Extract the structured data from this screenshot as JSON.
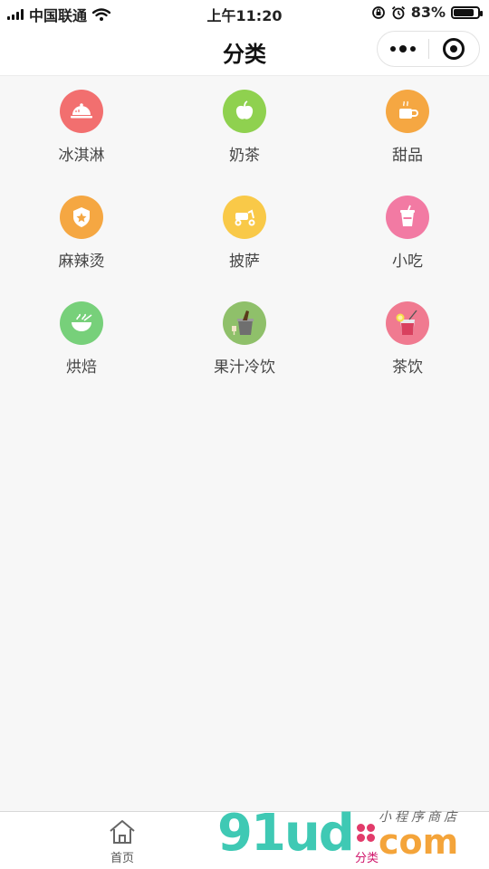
{
  "status_bar": {
    "carrier": "中国联通",
    "time": "上午11:20",
    "battery": "83%",
    "battery_level": 0.83
  },
  "nav": {
    "title": "分类"
  },
  "categories": [
    {
      "label": "冰淇淋",
      "icon": "cloche-icon",
      "color": "#f26f6f"
    },
    {
      "label": "奶茶",
      "icon": "apple-icon",
      "color": "#8fd14f"
    },
    {
      "label": "甜品",
      "icon": "coffee-cup-icon",
      "color": "#f5a742"
    },
    {
      "label": "麻辣烫",
      "icon": "star-badge-icon",
      "color": "#f5a742"
    },
    {
      "label": "披萨",
      "icon": "scooter-icon",
      "color": "#f9c948"
    },
    {
      "label": "小吃",
      "icon": "drink-cup-icon",
      "color": "#f27aa3"
    },
    {
      "label": "烘焙",
      "icon": "bowl-icon",
      "color": "#77d07a"
    },
    {
      "label": "果汁冷饮",
      "icon": "bottle-bucket-icon",
      "color": "#8fc06a"
    },
    {
      "label": "茶饮",
      "icon": "cocktail-icon",
      "color": "#f07a90"
    }
  ],
  "tab_bar": {
    "home_label": "首页",
    "category_label": "分类",
    "active_color": "#d0146a"
  },
  "watermark": {
    "main": "91ud",
    "com": "com",
    "sub": "小程序商店"
  }
}
